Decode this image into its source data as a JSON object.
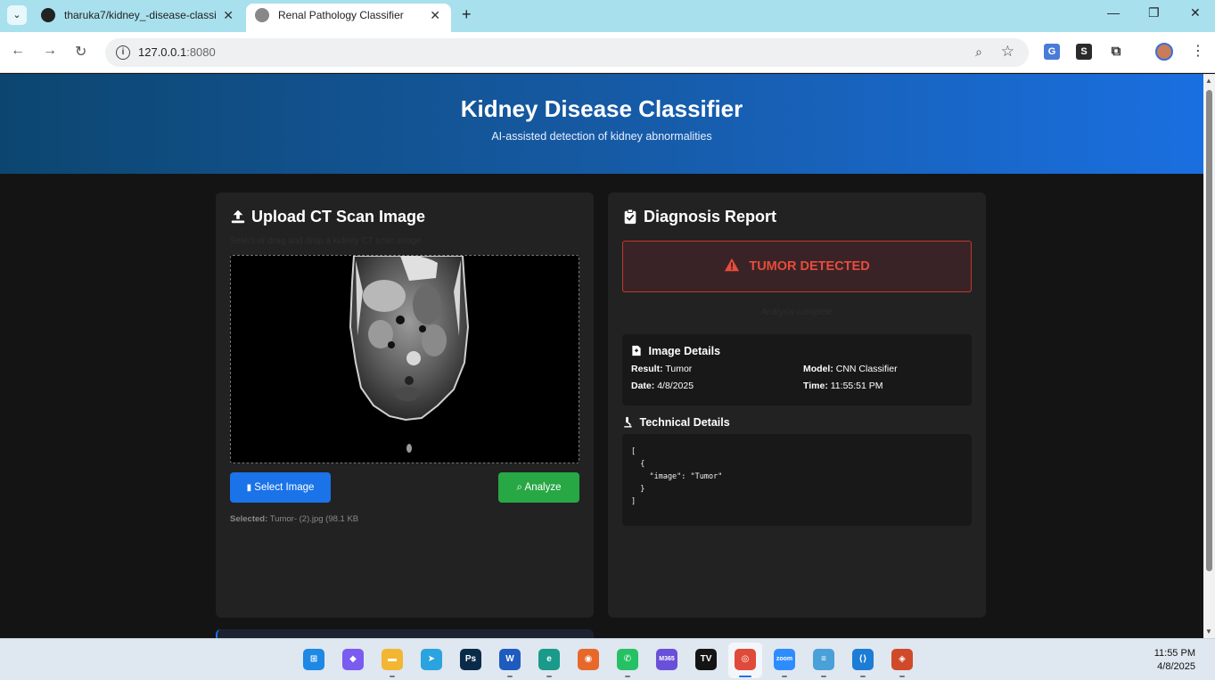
{
  "browser": {
    "tabs": [
      {
        "title": "tharuka7/kidney_-disease-classi",
        "icon": "github-icon",
        "active": false
      },
      {
        "title": "Renal Pathology Classifier",
        "icon": "globe-icon",
        "active": true
      }
    ],
    "new_tab": "+",
    "window_controls": {
      "minimize": "—",
      "restore": "❐",
      "close": "✕"
    },
    "nav": {
      "back": "←",
      "forward": "→",
      "reload": "↻"
    },
    "url_host": "127.0.0.1",
    "url_port": ":8080",
    "zoom_icon": "⌕",
    "star_icon": "☆",
    "extensions": [
      {
        "name": "translate-extension-icon",
        "label": "G",
        "color": "#4a7bd8"
      },
      {
        "name": "s-extension-icon",
        "label": "S",
        "color": "#2b2b2b"
      },
      {
        "name": "puzzle-extension-icon",
        "label": "⧉",
        "color": "#555555"
      }
    ],
    "menu_icon": "⋮"
  },
  "header": {
    "title": "Kidney Disease Classifier",
    "subtitle": "AI-assisted detection of kidney abnormalities"
  },
  "upload": {
    "title": "Upload CT Scan Image",
    "hint": "Select or drag and drop a kidney CT scan image",
    "select_button": "Select Image",
    "analyze_button": "Analyze",
    "selected_label": "Selected:",
    "selected_file": "Tumor- (2).jpg (98.1 KB"
  },
  "report": {
    "title": "Diagnosis Report",
    "alert": "TUMOR DETECTED",
    "faint_note": "Analysis complete",
    "image_details_title": "Image Details",
    "details": [
      {
        "label": "Result:",
        "value": "Tumor"
      },
      {
        "label": "Model:",
        "value": "CNN Classifier"
      },
      {
        "label": "Date:",
        "value": "4/8/2025"
      },
      {
        "label": "Time:",
        "value": "11:55:51 PM"
      }
    ],
    "technical_title": "Technical Details",
    "technical_json": "[\n  {\n    \"image\": \"Tumor\"\n  }\n]"
  },
  "colors": {
    "accent": "#1a73e8",
    "success": "#28a745",
    "danger": "#e74c3c"
  },
  "taskbar": {
    "apps": [
      {
        "name": "windows-start-icon",
        "label": "⊞",
        "color": "#1e88e5"
      },
      {
        "name": "copilot-icon",
        "label": "◆",
        "color": "#7b5cf0"
      },
      {
        "name": "file-explorer-icon",
        "label": "▬",
        "color": "#f2b632"
      },
      {
        "name": "telegram-icon",
        "label": "➤",
        "color": "#2aa3df"
      },
      {
        "name": "photoshop-icon",
        "label": "Ps",
        "color": "#0a2a4a"
      },
      {
        "name": "word-icon",
        "label": "W",
        "color": "#1e5bbf"
      },
      {
        "name": "edge-icon",
        "label": "e",
        "color": "#1a9a8a"
      },
      {
        "name": "firefox-icon",
        "label": "◉",
        "color": "#e8682a"
      },
      {
        "name": "whatsapp-icon",
        "label": "✆",
        "color": "#25c164"
      },
      {
        "name": "microsoft365-icon",
        "label": "M365",
        "color": "#6a4fd8"
      },
      {
        "name": "tradingview-icon",
        "label": "TV",
        "color": "#141414"
      },
      {
        "name": "chrome-icon",
        "label": "◎",
        "color": "#e04a3a"
      },
      {
        "name": "zoom-icon",
        "label": "zoom",
        "color": "#2d8cff"
      },
      {
        "name": "notepad-icon",
        "label": "≡",
        "color": "#4aa0d8"
      },
      {
        "name": "vscode-icon",
        "label": "⟨⟩",
        "color": "#1c7cd6"
      },
      {
        "name": "git-gui-icon",
        "label": "◈",
        "color": "#d04a2a"
      }
    ],
    "time": "11:55 PM",
    "date": "4/8/2025"
  }
}
